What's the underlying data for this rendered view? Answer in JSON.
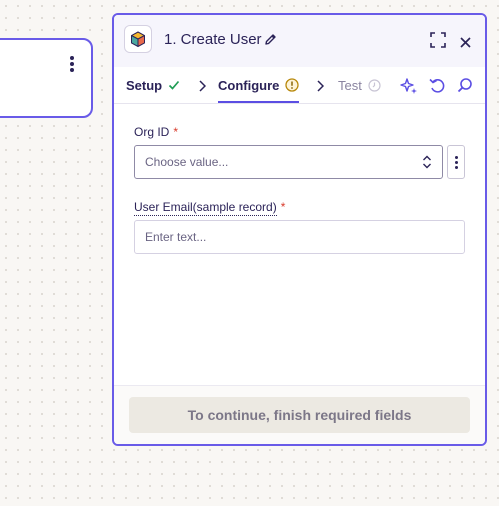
{
  "step": {
    "title": "1. Create User"
  },
  "tabs": [
    {
      "label": "Setup",
      "status": "complete"
    },
    {
      "label": "Configure",
      "status": "warning",
      "active": true
    },
    {
      "label": "Test",
      "status": "pending"
    }
  ],
  "fields": {
    "org_id": {
      "label": "Org ID",
      "required_mark": "*",
      "placeholder": "Choose value..."
    },
    "user_email": {
      "label": "User Email(sample record)",
      "required_mark": "*",
      "placeholder": "Enter text..."
    }
  },
  "footer": {
    "button_label": "To continue, finish required fields"
  },
  "colors": {
    "accent": "#695be8",
    "success": "#1f9d55",
    "warning": "#b7880b",
    "required": "#d83a2b",
    "text": "#2b2358",
    "canvas_bg": "#f9f7f4"
  },
  "icons": [
    "app-box-icon",
    "pencil-icon",
    "expand-icon",
    "close-icon",
    "check-icon",
    "warning-circle-icon",
    "pending-clock-icon",
    "chevron-right-icon",
    "sparkle-icon",
    "undo-icon",
    "search-icon",
    "chevron-updown-icon",
    "more-vertical-icon"
  ]
}
